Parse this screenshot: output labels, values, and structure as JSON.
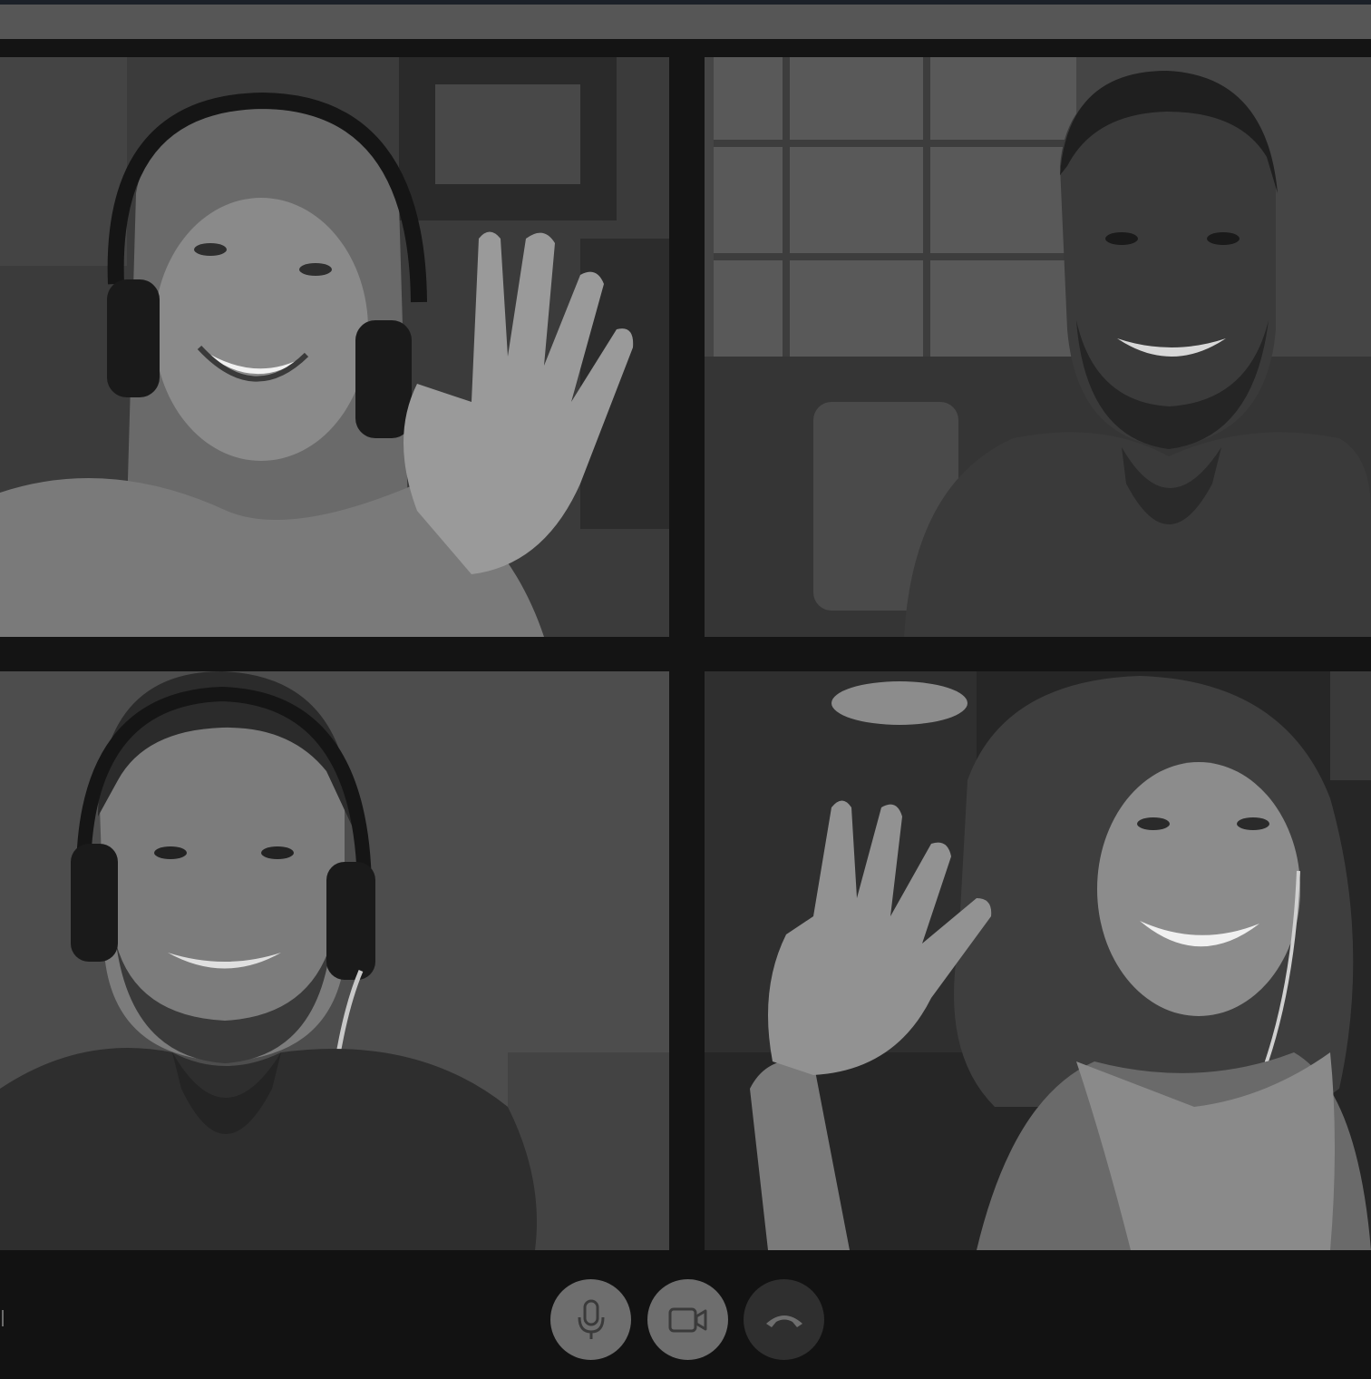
{
  "call": {
    "participants": [
      {
        "id": "p1",
        "description_icon": "person-video-icon"
      },
      {
        "id": "p2",
        "description_icon": "person-video-icon"
      },
      {
        "id": "p3",
        "description_icon": "person-video-icon"
      },
      {
        "id": "p4",
        "description_icon": "person-video-icon"
      }
    ]
  },
  "controls": {
    "mic": {
      "icon": "microphone-icon"
    },
    "camera": {
      "icon": "video-camera-icon"
    },
    "end_call": {
      "icon": "phone-hangup-icon"
    }
  },
  "colors": {
    "background": "#121212",
    "top_bar": "#565656",
    "button_active": "#6e6e6e",
    "button_end": "#2f2f2f"
  }
}
